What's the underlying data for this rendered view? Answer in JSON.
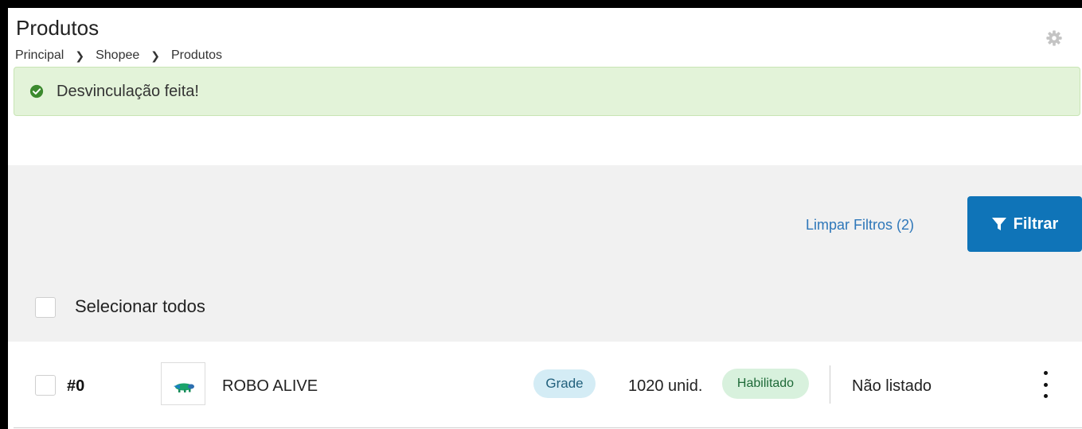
{
  "header": {
    "title": "Produtos",
    "breadcrumb": [
      "Principal",
      "Shopee",
      "Produtos"
    ]
  },
  "alert": {
    "message": "Desvinculação feita!",
    "icon": "check-circle-icon",
    "color": "#e3f3d9"
  },
  "filters": {
    "clear_label": "Limpar Filtros (2)",
    "filter_label": "Filtrar",
    "filter_button_color": "#0f74b8"
  },
  "list": {
    "select_all_label": "Selecionar todos",
    "rows": [
      {
        "sku": "#0",
        "name": "ROBO ALIVE",
        "type_badge": "Grade",
        "quantity": "1020 unid.",
        "status_badge": "Habilitado",
        "listing_status": "Não listado"
      }
    ]
  }
}
